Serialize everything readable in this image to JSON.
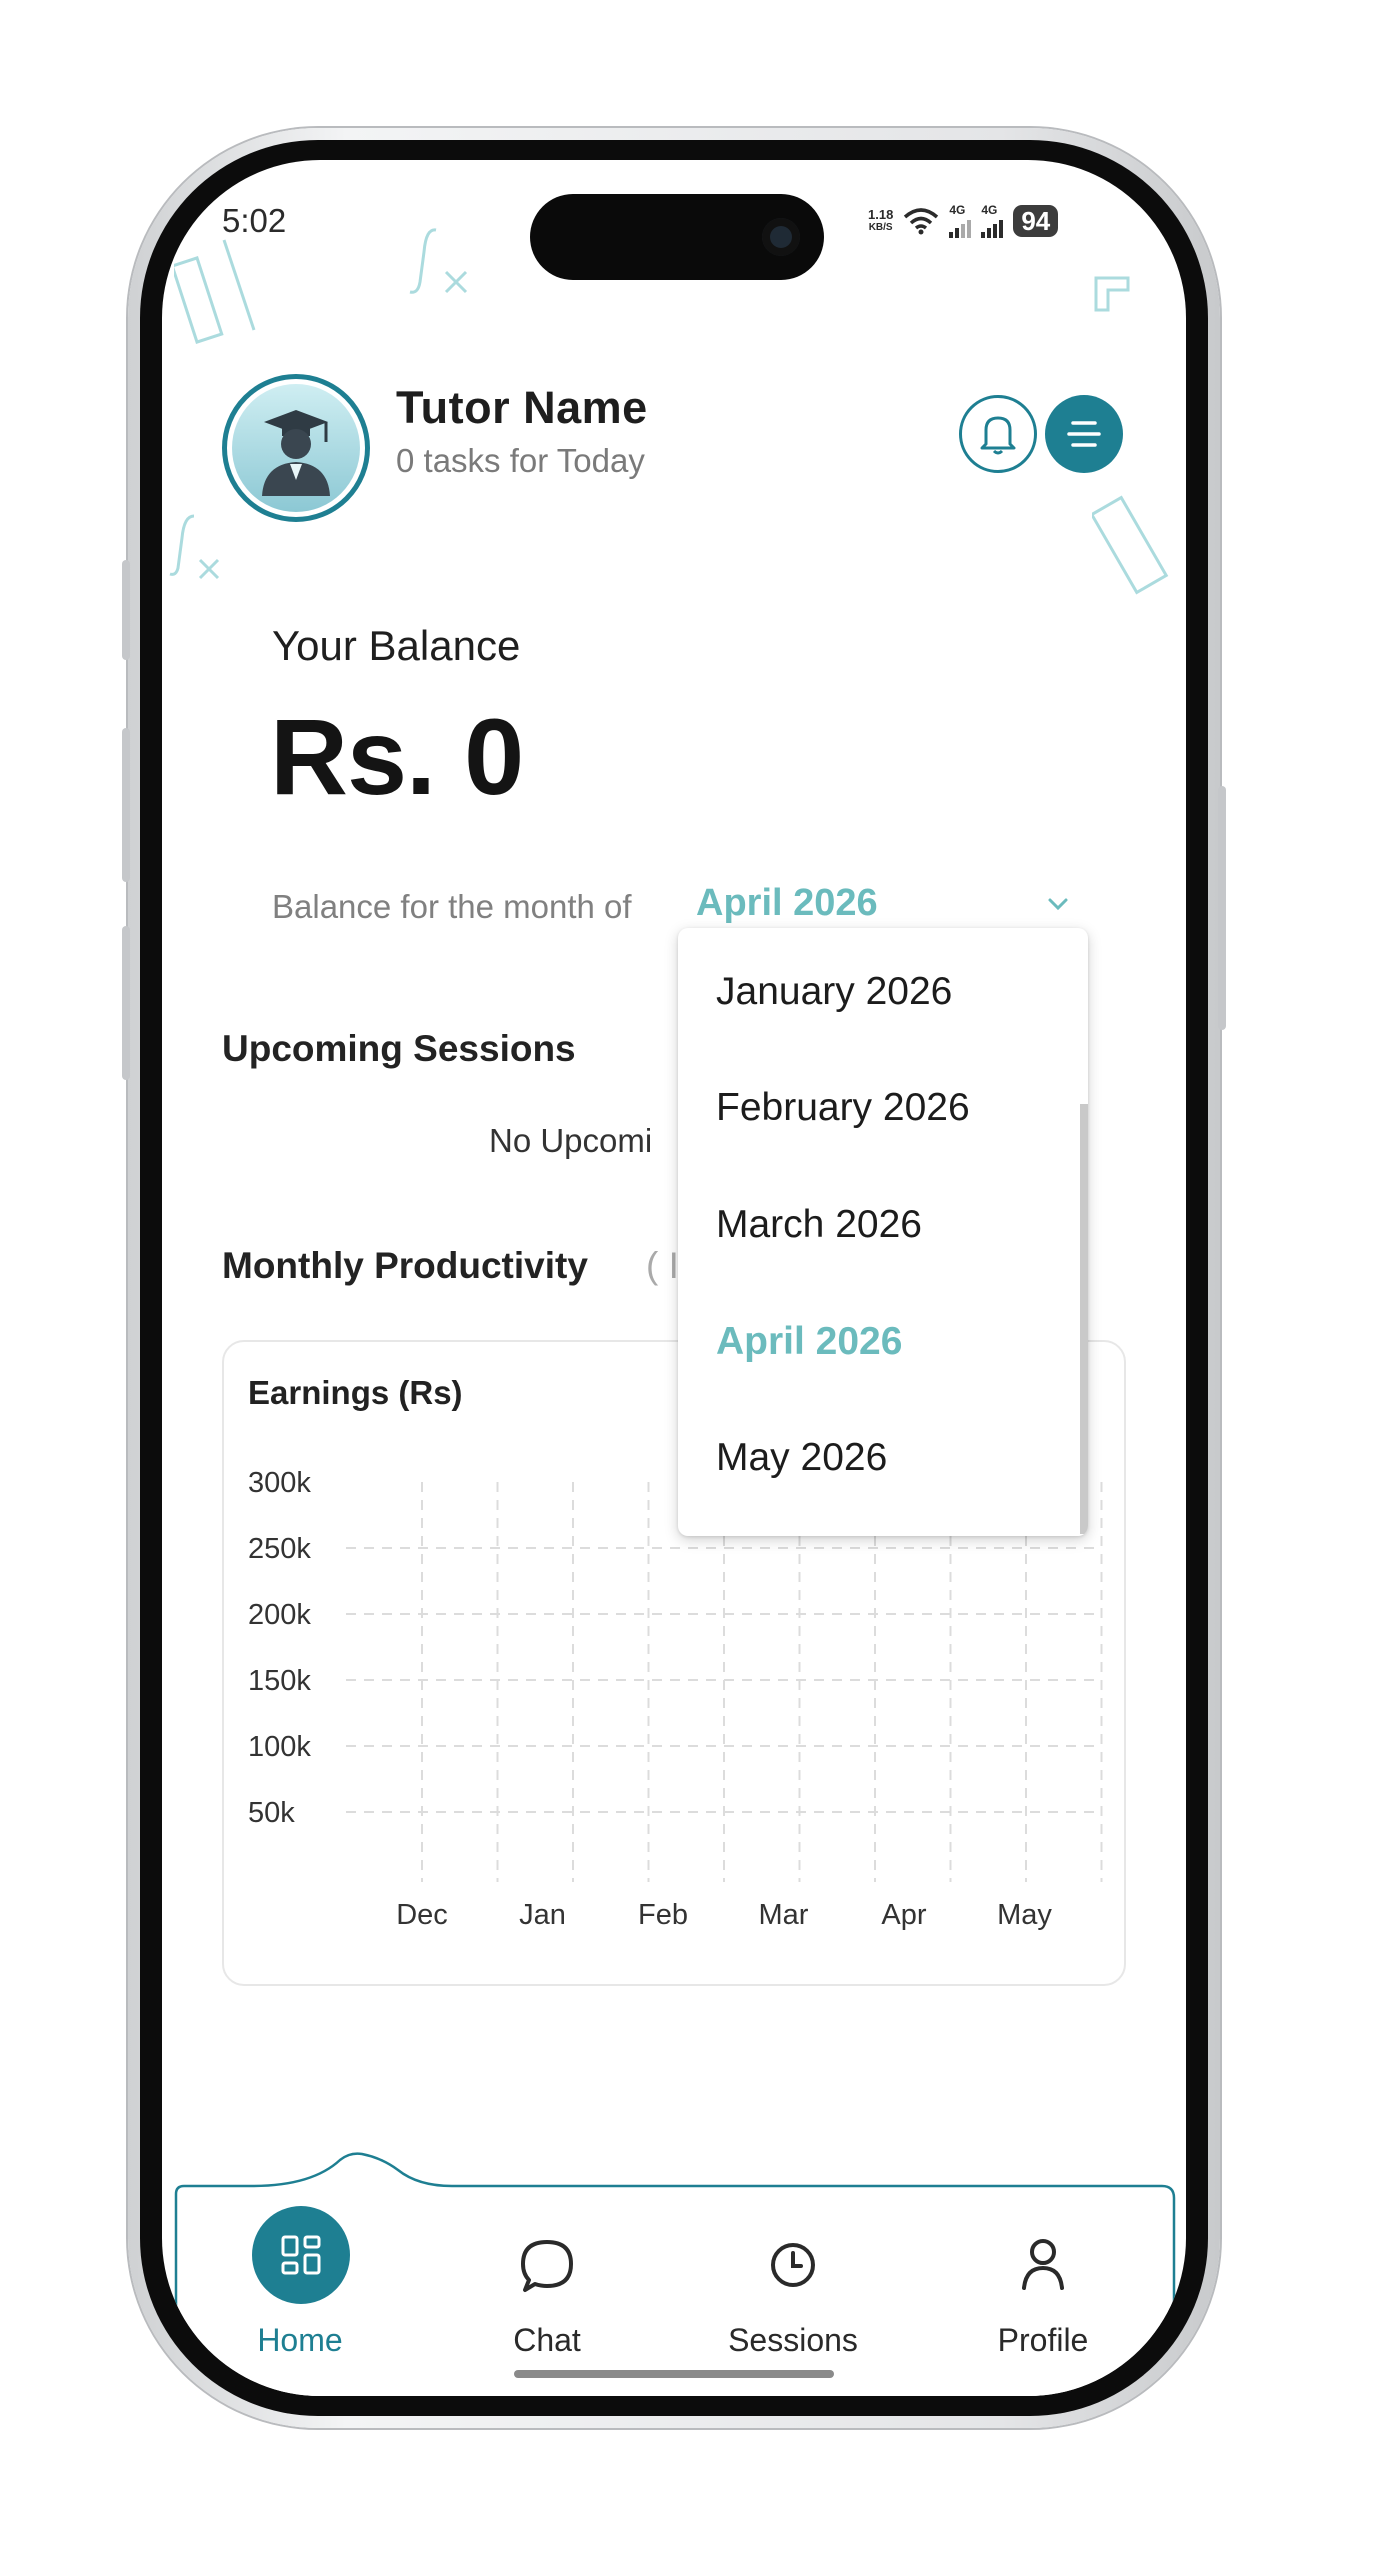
{
  "status_bar": {
    "time": "5:02",
    "net_speed_value": "1.18",
    "net_speed_unit": "KB/S",
    "sim1": "4G",
    "sim2": "4G",
    "battery": "94"
  },
  "header": {
    "tutor_name": "Tutor  Name",
    "tasks_text": "0 tasks for Today"
  },
  "balance": {
    "label": "Your Balance",
    "amount": "Rs. 0",
    "month_prefix": "Balance for the month of",
    "selected_month": "April 2026"
  },
  "dropdown": {
    "options": [
      "January 2026",
      "February 2026",
      "March 2026",
      "April 2026",
      "May 2026"
    ],
    "selected_index": 3
  },
  "upcoming": {
    "title": "Upcoming Sessions",
    "empty_text": "No Upcomi"
  },
  "productivity": {
    "title": "Monthly Productivity",
    "paren_text": "( I"
  },
  "chart_data": {
    "type": "line",
    "title": "Earnings (Rs)",
    "categories": [
      "Dec",
      "Jan",
      "Feb",
      "Mar",
      "Apr",
      "May"
    ],
    "y_ticks": [
      "300k",
      "250k",
      "200k",
      "150k",
      "100k",
      "50k"
    ],
    "series": [],
    "grid": true
  },
  "nav": {
    "items": [
      {
        "label": "Home",
        "icon": "dashboard-icon",
        "active": true
      },
      {
        "label": "Chat",
        "icon": "chat-bubble-icon",
        "active": false
      },
      {
        "label": "Sessions",
        "icon": "clock-icon",
        "active": false
      },
      {
        "label": "Profile",
        "icon": "person-icon",
        "active": false
      }
    ]
  },
  "colors": {
    "accent": "#1e7f92",
    "accent_light": "#6bbbbd",
    "grid": "#dcdcdc"
  }
}
